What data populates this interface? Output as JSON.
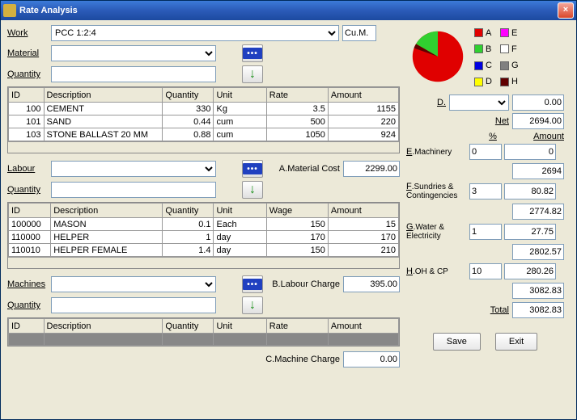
{
  "title": "Rate Analysis",
  "work": {
    "label": "Work",
    "value": "PCC 1:2:4",
    "unit": "Cu.M."
  },
  "material": {
    "label": "Material",
    "qty_label": "Quantity"
  },
  "labour": {
    "label": "Labour",
    "qty_label": "Quantity"
  },
  "machines": {
    "label": "Machines",
    "qty_label": "Quantity"
  },
  "grid_headers": {
    "id": "ID",
    "desc": "Description",
    "qty": "Quantity",
    "unit": "Unit",
    "rate": "Rate",
    "amount": "Amount",
    "wage": "Wage"
  },
  "material_rows": [
    {
      "id": "100",
      "desc": "CEMENT",
      "qty": "330",
      "unit": "Kg",
      "rate": "3.5",
      "amount": "1155"
    },
    {
      "id": "101",
      "desc": "SAND",
      "qty": "0.44",
      "unit": "cum",
      "rate": "500",
      "amount": "220"
    },
    {
      "id": "103",
      "desc": "STONE BALLAST 20 MM",
      "qty": "0.88",
      "unit": "cum",
      "rate": "1050",
      "amount": "924"
    }
  ],
  "labour_rows": [
    {
      "id": "100000",
      "desc": "MASON",
      "qty": "0.1",
      "unit": "Each",
      "wage": "150",
      "amount": "15"
    },
    {
      "id": "110000",
      "desc": "HELPER",
      "qty": "1",
      "unit": "day",
      "wage": "170",
      "amount": "170"
    },
    {
      "id": "110010",
      "desc": "HELPER FEMALE",
      "qty": "1.4",
      "unit": "day",
      "wage": "150",
      "amount": "210"
    }
  ],
  "cost_labels": {
    "material": "A.Material Cost",
    "material_val": "2299.00",
    "labour": "B.Labour Charge",
    "labour_val": "395.00",
    "machine": "C.Machine Charge",
    "machine_val": "0.00"
  },
  "legend": [
    {
      "label": "A",
      "color": "#e00000"
    },
    {
      "label": "E",
      "color": "#ff00ff"
    },
    {
      "label": "B",
      "color": "#30d030"
    },
    {
      "label": "F",
      "color": "#ffffff"
    },
    {
      "label": "C",
      "color": "#0000e0"
    },
    {
      "label": "G",
      "color": "#808080"
    },
    {
      "label": "D",
      "color": "#ffff00"
    },
    {
      "label": "H",
      "color": "#600000"
    }
  ],
  "chart_data": {
    "type": "pie",
    "series": [
      {
        "name": "A",
        "value": 2299,
        "color": "#e00000"
      },
      {
        "name": "B",
        "value": 395,
        "color": "#30d030"
      },
      {
        "name": "C",
        "value": 0,
        "color": "#0000e0"
      },
      {
        "name": "D",
        "value": 0,
        "color": "#ffff00"
      },
      {
        "name": "E",
        "value": 0,
        "color": "#ff00ff"
      },
      {
        "name": "F",
        "value": 0,
        "color": "#ffffff"
      },
      {
        "name": "G",
        "value": 0,
        "color": "#808080"
      },
      {
        "name": "H",
        "value": 0,
        "color": "#600000"
      }
    ]
  },
  "calc": {
    "d_label": "D.",
    "d_val": "0.00",
    "net_label": "Net",
    "net_val": "2694.00",
    "pct_label": "%",
    "amt_label": "Amount",
    "e_label": "E.Machinery",
    "e_in": "0",
    "e_out": "0",
    "sub1": "2694",
    "f_label": "F.Sundries & Contingencies",
    "f_in": "3",
    "f_out": "80.82",
    "sub2": "2774.82",
    "g_label": "G.Water & Electricity",
    "g_in": "1",
    "g_out": "27.75",
    "sub3": "2802.57",
    "h_label": "H.OH & CP",
    "h_in": "10",
    "h_out": "280.26",
    "sub4": "3082.83",
    "total_label": "Total",
    "total_val": "3082.83"
  },
  "buttons": {
    "save": "Save",
    "exit": "Exit"
  }
}
